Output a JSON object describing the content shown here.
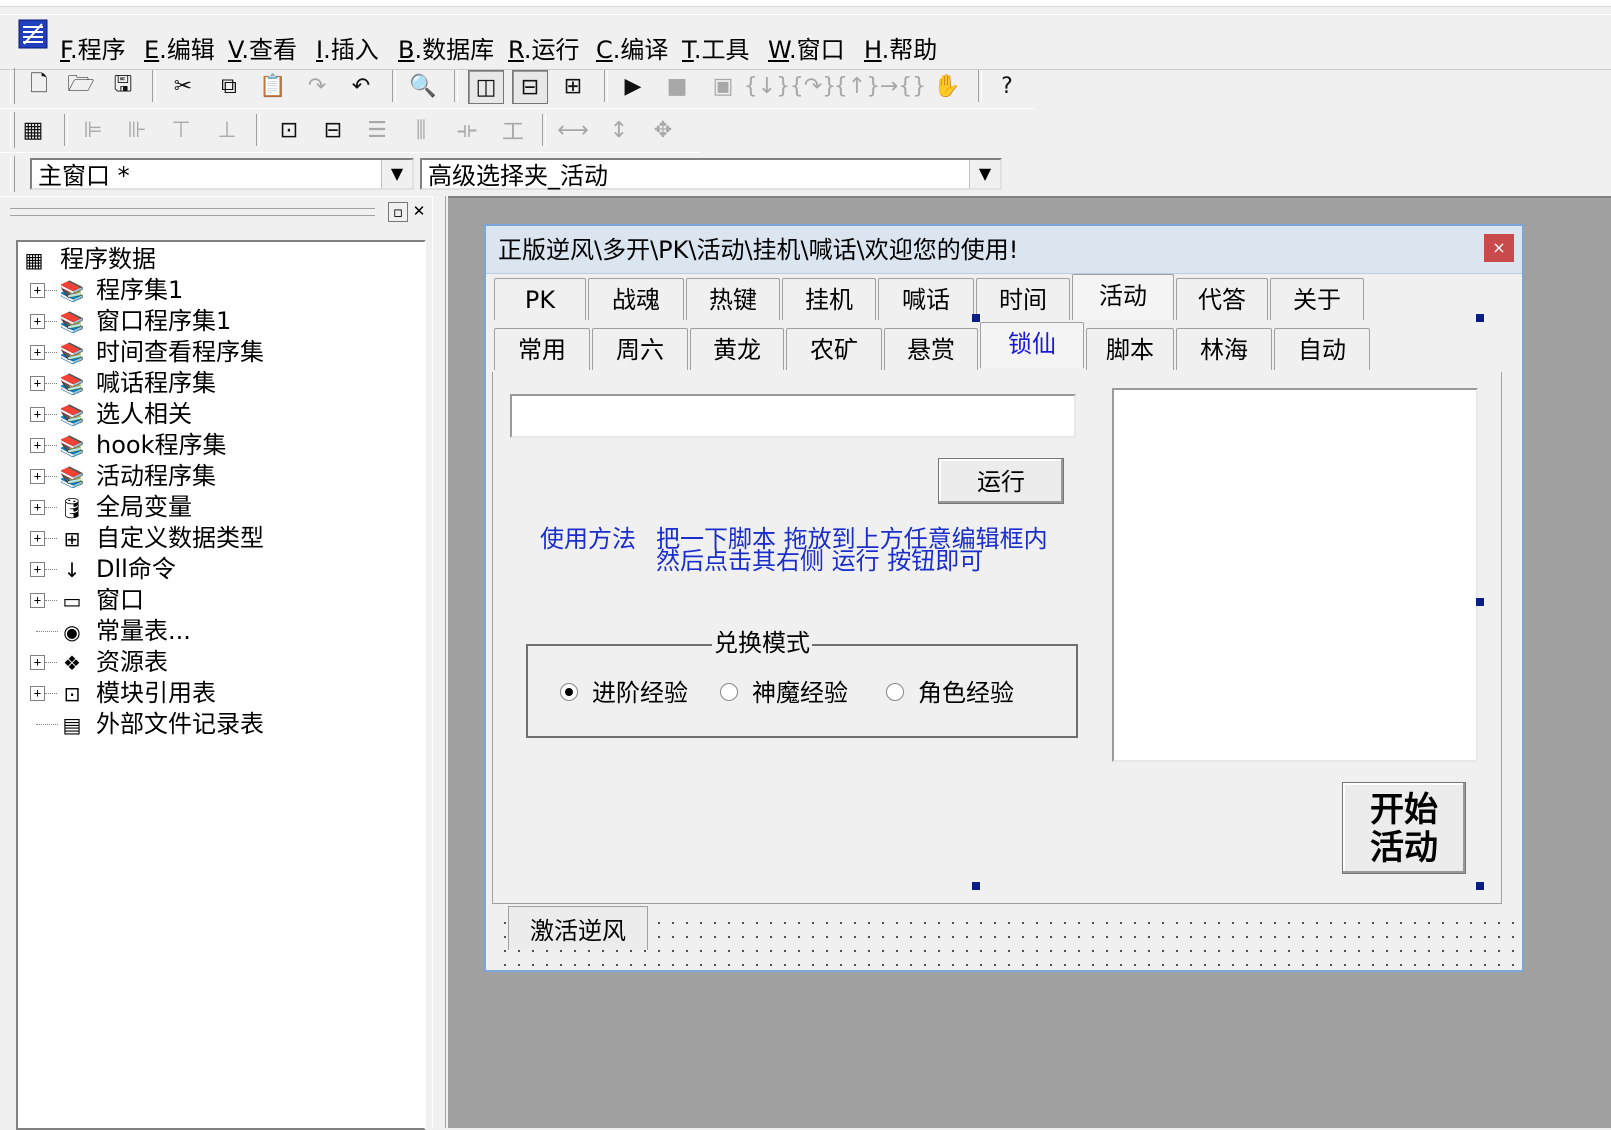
{
  "menu": {
    "items": [
      {
        "key": "F",
        "label": "程序"
      },
      {
        "key": "E",
        "label": "编辑"
      },
      {
        "key": "V",
        "label": "查看"
      },
      {
        "key": "I",
        "label": "插入"
      },
      {
        "key": "B",
        "label": "数据库"
      },
      {
        "key": "R",
        "label": "运行"
      },
      {
        "key": "C",
        "label": "编译"
      },
      {
        "key": "T",
        "label": "工具"
      },
      {
        "key": "W",
        "label": "窗口"
      },
      {
        "key": "H",
        "label": "帮助"
      }
    ]
  },
  "combos": {
    "window_select": "主窗口 *",
    "control_select": "高级选择夹_活动"
  },
  "tree": {
    "root": "程序数据",
    "items": [
      {
        "label": "程序集1",
        "icon": "stack-icon",
        "expand": true
      },
      {
        "label": "窗口程序集1",
        "icon": "stack-icon",
        "expand": true
      },
      {
        "label": "时间查看程序集",
        "icon": "stack-icon",
        "expand": true
      },
      {
        "label": "喊话程序集",
        "icon": "stack-icon",
        "expand": true
      },
      {
        "label": "选人相关",
        "icon": "stack-icon",
        "expand": true
      },
      {
        "label": "hook程序集",
        "icon": "stack-icon",
        "expand": true
      },
      {
        "label": "活动程序集",
        "icon": "stack-icon",
        "expand": true
      },
      {
        "label": "全局变量",
        "icon": "database-icon",
        "expand": true
      },
      {
        "label": "自定义数据类型",
        "icon": "datatype-icon",
        "expand": true
      },
      {
        "label": "Dll命令",
        "icon": "dll-icon",
        "expand": true
      },
      {
        "label": "窗口",
        "icon": "window-icon",
        "expand": true
      },
      {
        "label": "常量表...",
        "icon": "constants-icon",
        "expand": false
      },
      {
        "label": "资源表",
        "icon": "resources-icon",
        "expand": true
      },
      {
        "label": "模块引用表",
        "icon": "module-icon",
        "expand": true
      },
      {
        "label": "外部文件记录表",
        "icon": "file-icon",
        "expand": false
      }
    ]
  },
  "form": {
    "title": "正版逆风\\多开\\PK\\活动\\挂机\\喊话\\欢迎您的使用!",
    "close": "×",
    "tabs_row1": [
      "PK",
      "战魂",
      "热键",
      "挂机",
      "喊话",
      "时间",
      "活动",
      "代答",
      "关于"
    ],
    "tabs_row2": [
      "常用",
      "周六",
      "黄龙",
      "农矿",
      "悬赏",
      "锁仙",
      "脚本",
      "林海",
      "自动"
    ],
    "run_label": "运行",
    "usage_label": "使用方法",
    "usage_line1": "把一下脚本 拖放到上方任意编辑框内",
    "usage_line2": "然后点击其右侧 运行 按钮即可",
    "group_label": "兑换模式",
    "radios": [
      {
        "label": "进阶经验",
        "checked": true
      },
      {
        "label": "神魔经验",
        "checked": false
      },
      {
        "label": "角色经验",
        "checked": false
      }
    ],
    "start_line1": "开始",
    "start_line2": "活动",
    "activate_label": "激活逆风"
  }
}
